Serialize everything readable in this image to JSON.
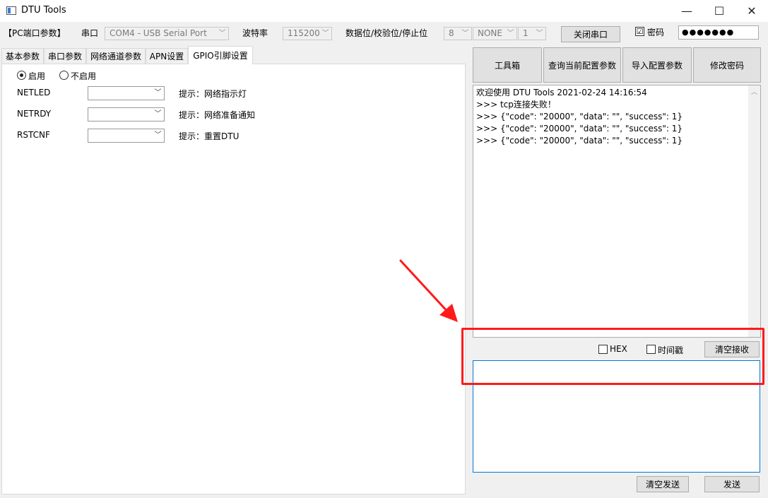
{
  "window": {
    "title": "DTU Tools",
    "minimize_glyph": "—",
    "maximize_glyph": "☐",
    "close_glyph": "✕",
    "icon": "app-window-icon"
  },
  "toolbar": {
    "section_label": "【PC端口参数】",
    "port_label": "串口",
    "port_value": "COM4 - USB Serial Port",
    "baud_label": "波特率",
    "baud_value": "115200",
    "format_label": "数据位/校验位/停止位",
    "databits_value": "8",
    "parity_value": "NONE",
    "stopbits_value": "1",
    "close_port_button": "关闭串口",
    "password_checkbox_label": "密码",
    "password_checked": "☑",
    "password_value": "●●●●●●●"
  },
  "tabs": [
    {
      "label": "基本参数"
    },
    {
      "label": "串口参数"
    },
    {
      "label": "网络通道参数"
    },
    {
      "label": "APN设置"
    },
    {
      "label": "GPIO引脚设置"
    }
  ],
  "gpio": {
    "enable_label": "启用",
    "disable_label": "不启用",
    "rows": [
      {
        "name": "NETLED",
        "value": "",
        "hint": "提示：网络指示灯"
      },
      {
        "name": "NETRDY",
        "value": "",
        "hint": "提示：网络准备通知"
      },
      {
        "name": "RSTCNF",
        "value": "",
        "hint": "提示：重置DTU"
      }
    ]
  },
  "actions": {
    "toolbox": "工具箱",
    "query_config": "查询当前配置参数",
    "import_config": "导入配置参数",
    "change_password": "修改密码"
  },
  "log": {
    "lines": [
      "欢迎使用 DTU Tools 2021-02-24 14:16:54",
      ">>> tcp连接失败！",
      ">>> {\"code\": \"20000\", \"data\": \"\", \"success\": 1}",
      ">>> {\"code\": \"20000\", \"data\": \"\", \"success\": 1}",
      ">>> {\"code\": \"20000\", \"data\": \"\", \"success\": 1}"
    ]
  },
  "receive_options": {
    "hex_label": "HEX",
    "timestamp_label": "时间戳",
    "clear_receive": "清空接收"
  },
  "send": {
    "input_value": "",
    "clear_send": "清空发送",
    "send_button": "发送"
  },
  "colors": {
    "highlight": "#ff1a1a",
    "focus_border": "#0078d7"
  }
}
